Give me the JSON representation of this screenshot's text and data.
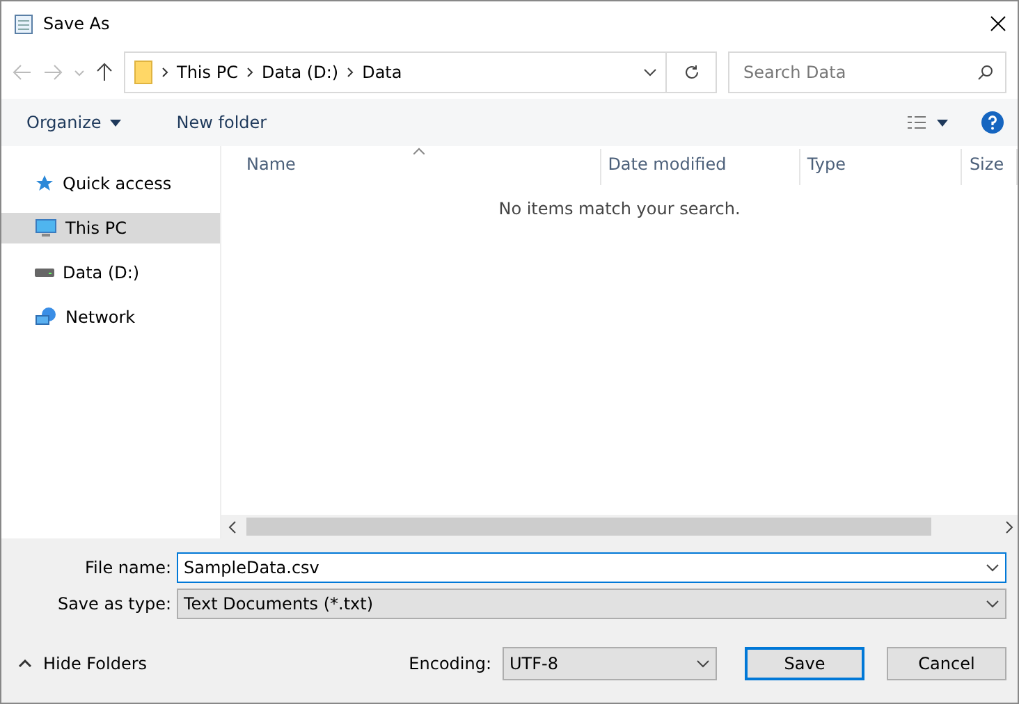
{
  "window": {
    "title": "Save As"
  },
  "address_bar": {
    "breadcrumbs": [
      "This PC",
      "Data (D:)",
      "Data"
    ]
  },
  "search": {
    "placeholder": "Search Data"
  },
  "toolbar": {
    "organize": "Organize",
    "new_folder": "New folder"
  },
  "sidebar": {
    "items": [
      {
        "label": "Quick access",
        "kind": "star",
        "selected": false
      },
      {
        "label": "This PC",
        "kind": "computer",
        "selected": true
      },
      {
        "label": "Data (D:)",
        "kind": "drive",
        "selected": false
      },
      {
        "label": "Network",
        "kind": "network",
        "selected": false
      }
    ]
  },
  "table": {
    "columns": [
      "Name",
      "Date modified",
      "Type",
      "Size"
    ],
    "empty_message": "No items match your search."
  },
  "file_name": {
    "label": "File name:",
    "value": "SampleData.csv"
  },
  "save_as_type": {
    "label": "Save as type:",
    "value": "Text Documents (*.txt)"
  },
  "hide_folders": "Hide Folders",
  "encoding": {
    "label": "Encoding:",
    "value": "UTF-8"
  },
  "buttons": [
    {
      "label": "Save",
      "default": true
    },
    {
      "label": "Cancel",
      "default": false
    }
  ]
}
